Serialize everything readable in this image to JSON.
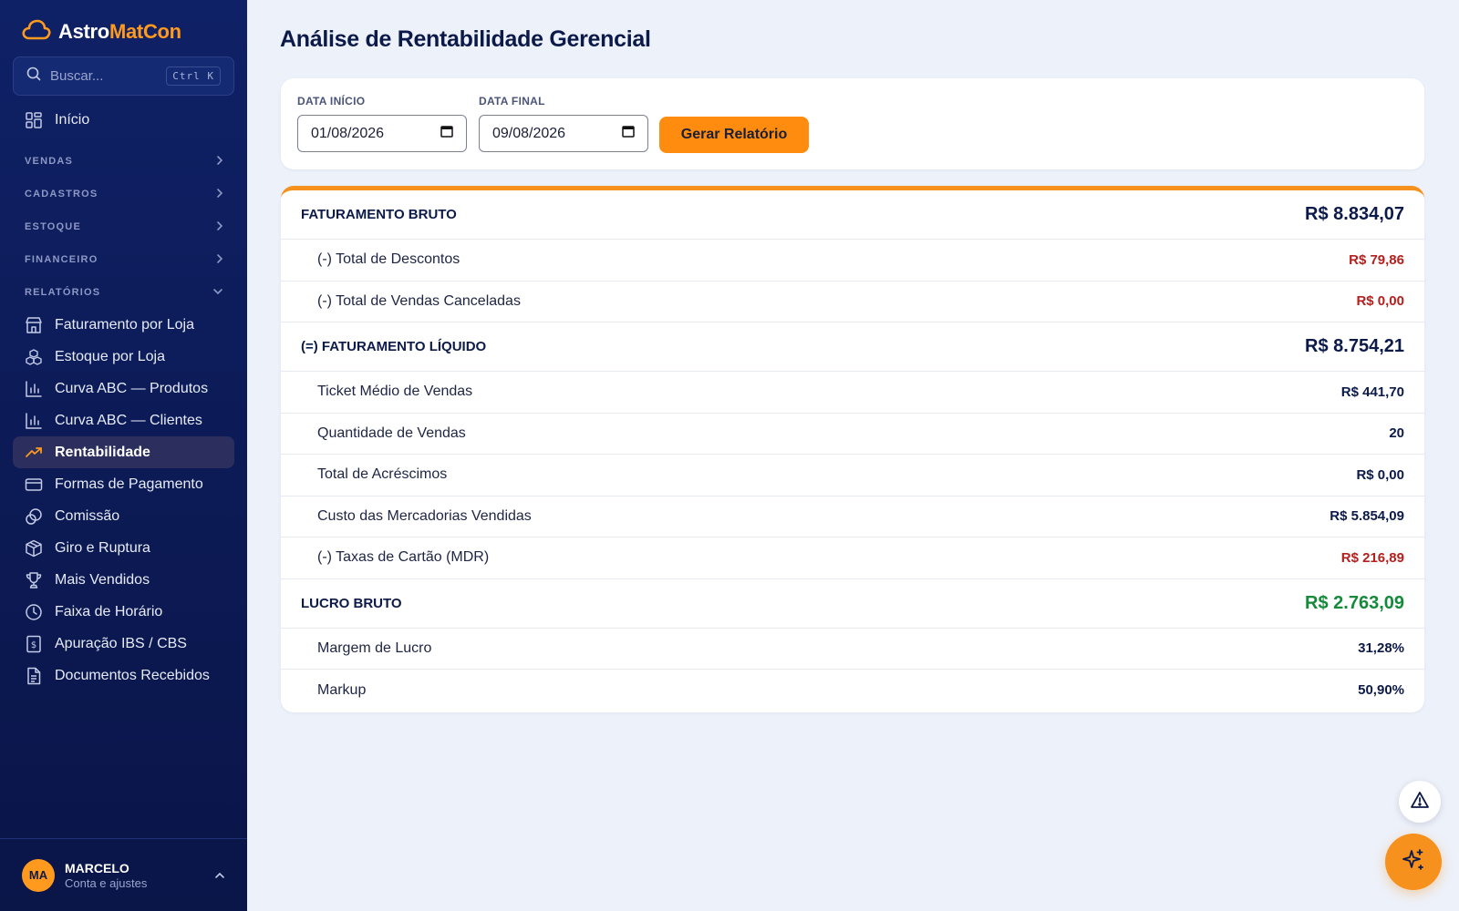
{
  "app": {
    "brand_part1": "Astro",
    "brand_part2": "MatCon",
    "accent_color": "#ff9a1f",
    "sidebar_color": "#0f2166"
  },
  "search": {
    "placeholder": "Buscar...",
    "shortcut": "Ctrl K",
    "icon": "search-icon"
  },
  "nav": {
    "home": {
      "label": "Início",
      "icon": "dashboard-icon"
    },
    "sections": [
      {
        "label": "VENDAS",
        "expanded": false
      },
      {
        "label": "CADASTROS",
        "expanded": false
      },
      {
        "label": "ESTOQUE",
        "expanded": false
      },
      {
        "label": "FINANCEIRO",
        "expanded": false
      },
      {
        "label": "RELATÓRIOS",
        "expanded": true
      }
    ],
    "reports": [
      {
        "label": "Faturamento por Loja",
        "icon": "store-icon",
        "active": false
      },
      {
        "label": "Estoque por Loja",
        "icon": "boxes-icon",
        "active": false
      },
      {
        "label": "Curva ABC — Produtos",
        "icon": "bar-chart-icon",
        "active": false
      },
      {
        "label": "Curva ABC — Clientes",
        "icon": "bar-chart-icon",
        "active": false
      },
      {
        "label": "Rentabilidade",
        "icon": "trending-up-icon",
        "active": true
      },
      {
        "label": "Formas de Pagamento",
        "icon": "credit-card-icon",
        "active": false
      },
      {
        "label": "Comissão",
        "icon": "coins-icon",
        "active": false
      },
      {
        "label": "Giro e Ruptura",
        "icon": "package-icon",
        "active": false
      },
      {
        "label": "Mais Vendidos",
        "icon": "trophy-icon",
        "active": false
      },
      {
        "label": "Faixa de Horário",
        "icon": "clock-icon",
        "active": false
      },
      {
        "label": "Apuração IBS / CBS",
        "icon": "receipt-dollar-icon",
        "active": false
      },
      {
        "label": "Documentos Recebidos",
        "icon": "document-icon",
        "active": false
      }
    ]
  },
  "user": {
    "initials": "MA",
    "name": "MARCELO",
    "subtitle": "Conta e ajustes"
  },
  "page": {
    "title": "Análise de Rentabilidade Gerencial"
  },
  "filters": {
    "start_label": "DATA INÍCIO",
    "start_value": "01/08/2026",
    "end_label": "DATA FINAL",
    "end_value": "09/08/2026",
    "button_label": "Gerar Relatório"
  },
  "report": {
    "rows": [
      {
        "label": "FATURAMENTO BRUTO",
        "value": "R$ 8.834,07",
        "kind": "major",
        "tone": "normal"
      },
      {
        "label": "(-) Total de Descontos",
        "value": "R$ 79,86",
        "kind": "minor",
        "tone": "red"
      },
      {
        "label": "(-) Total de Vendas Canceladas",
        "value": "R$ 0,00",
        "kind": "minor",
        "tone": "red"
      },
      {
        "label": "(=) FATURAMENTO LÍQUIDO",
        "value": "R$ 8.754,21",
        "kind": "major",
        "tone": "normal"
      },
      {
        "label": "Ticket Médio de Vendas",
        "value": "R$ 441,70",
        "kind": "minor",
        "tone": "normal"
      },
      {
        "label": "Quantidade de Vendas",
        "value": "20",
        "kind": "minor",
        "tone": "normal"
      },
      {
        "label": "Total de Acréscimos",
        "value": "R$ 0,00",
        "kind": "minor",
        "tone": "normal"
      },
      {
        "label": "Custo das Mercadorias Vendidas",
        "value": "R$ 5.854,09",
        "kind": "minor",
        "tone": "normal"
      },
      {
        "label": "(-) Taxas de Cartão (MDR)",
        "value": "R$ 216,89",
        "kind": "minor",
        "tone": "red"
      },
      {
        "label": "LUCRO BRUTO",
        "value": "R$ 2.763,09",
        "kind": "major",
        "tone": "green"
      },
      {
        "label": "Margem de Lucro",
        "value": "31,28%",
        "kind": "minor",
        "tone": "normal"
      },
      {
        "label": "Markup",
        "value": "50,90%",
        "kind": "minor",
        "tone": "normal"
      }
    ]
  },
  "fabs": {
    "warning_icon": "alert-triangle-icon",
    "ai_icon": "sparkles-icon"
  }
}
